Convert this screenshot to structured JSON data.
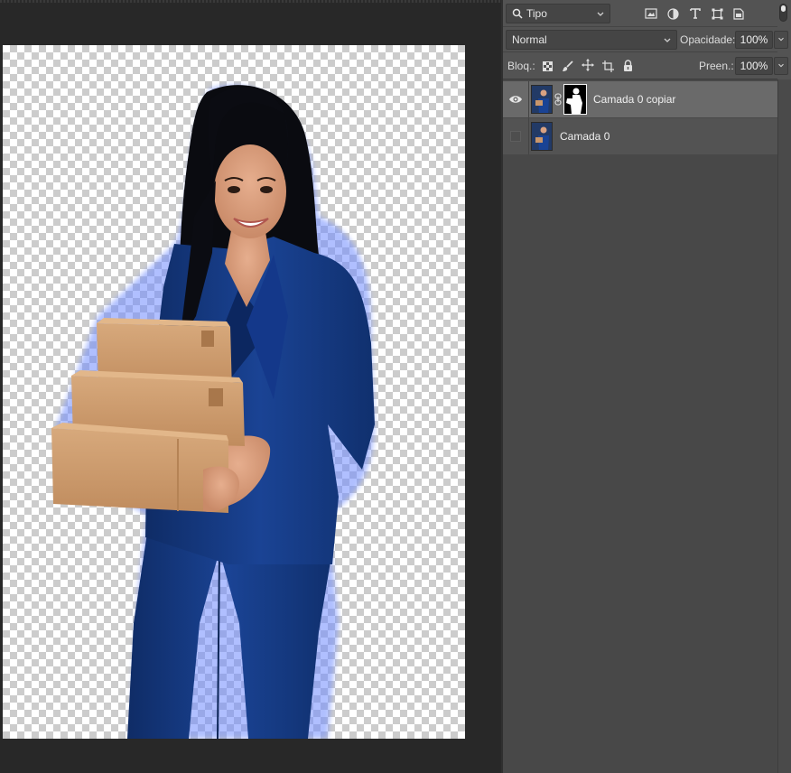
{
  "layers_panel": {
    "filter": {
      "kind_label": "Tipo",
      "icons": [
        "image-filter-icon",
        "adjustment-filter-icon",
        "type-filter-icon",
        "shape-filter-icon",
        "smart-object-filter-icon"
      ]
    },
    "blend_mode": "Normal",
    "opacity_label": "Opacidade:",
    "opacity_value": "100%",
    "lock_label": "Bloq.:",
    "lock_icons": [
      "lock-transparent-icon",
      "lock-paint-icon",
      "lock-position-icon",
      "lock-artboard-icon",
      "lock-all-icon"
    ],
    "fill_label": "Preen.:",
    "fill_value": "100%",
    "layers": [
      {
        "name": "Camada 0 copiar",
        "visible": true,
        "selected": true,
        "has_mask": true
      },
      {
        "name": "Camada 0",
        "visible": false,
        "selected": false,
        "has_mask": false
      }
    ]
  },
  "colors": {
    "panel_bg": "#535353",
    "selected_layer": "#6a6a6a",
    "workspace_bg": "#282828",
    "suit_blue": "#173f87",
    "box_brown": "#c9966a"
  }
}
